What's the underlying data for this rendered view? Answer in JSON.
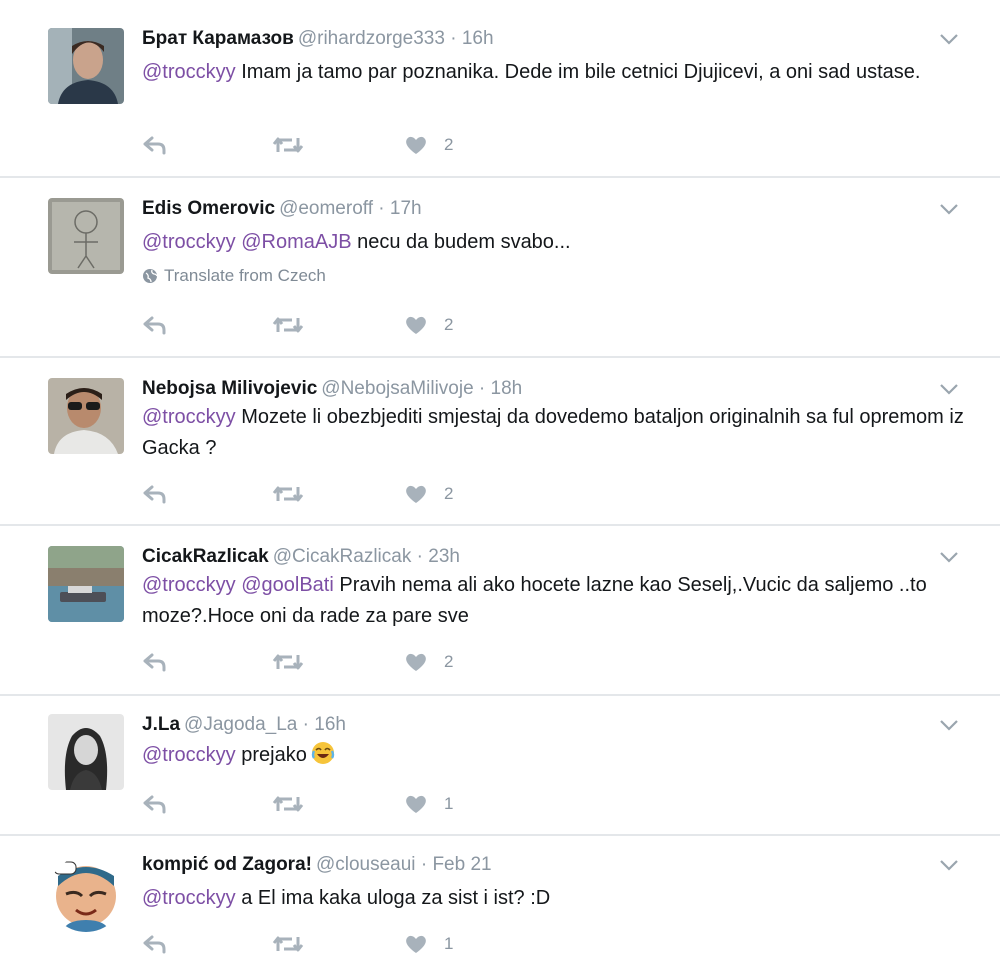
{
  "colors": {
    "mention": "#7d4fa5",
    "meta": "#8b96a1",
    "divider": "#e4e7ea",
    "icon": "#a8b2bb"
  },
  "icons": {
    "reply": "reply-icon",
    "retweet": "retweet-icon",
    "like": "heart-icon",
    "more": "chevron-down-icon",
    "translate": "globe-icon"
  },
  "tweets": [
    {
      "name": "Брат Карамазов",
      "handle": "@rihardzorge333",
      "time": "16h",
      "mentions": [
        "@trocckyy"
      ],
      "text": "Imam ja tamo par poznanika. Dede im bile cetnici Djujicevi, a oni sad ustase.",
      "likes": "2"
    },
    {
      "name": "Edis Omerovic",
      "handle": "@eomeroff",
      "time": "17h",
      "mentions": [
        "@trocckyy",
        "@RomaAJB"
      ],
      "text": "necu da budem svabo...",
      "translate": "Translate from Czech",
      "likes": "2"
    },
    {
      "name": "Nebojsa Milivojevic",
      "handle": "@NebojsaMilivoje",
      "time": "18h",
      "mentions": [
        "@trocckyy"
      ],
      "text": "Mozete li obezbjediti smjestaj da dovedemo bataljon originalnih sa ful opremom iz Gacka ?",
      "likes": "2"
    },
    {
      "name": "CicakRazlicak",
      "handle": "@CicakRazlicak",
      "time": "23h",
      "mentions": [
        "@trocckyy",
        "@goolBati"
      ],
      "text": "Pravih nema ali ako hocete lazne kao Seselj,.Vucic da saljemo ..to moze?.Hoce oni da rade za pare sve",
      "likes": "2"
    },
    {
      "name": "J.La",
      "handle": "@Jagoda_La",
      "time": "16h",
      "mentions": [
        "@trocckyy"
      ],
      "text": "prejako",
      "likes": "1"
    },
    {
      "name": "kompić od Zagora!",
      "handle": "@clouseaui",
      "time": "Feb 21",
      "mentions": [
        "@trocckyy"
      ],
      "text": "a El ima kaka uloga za sist i ist? :D",
      "likes": "1"
    }
  ]
}
